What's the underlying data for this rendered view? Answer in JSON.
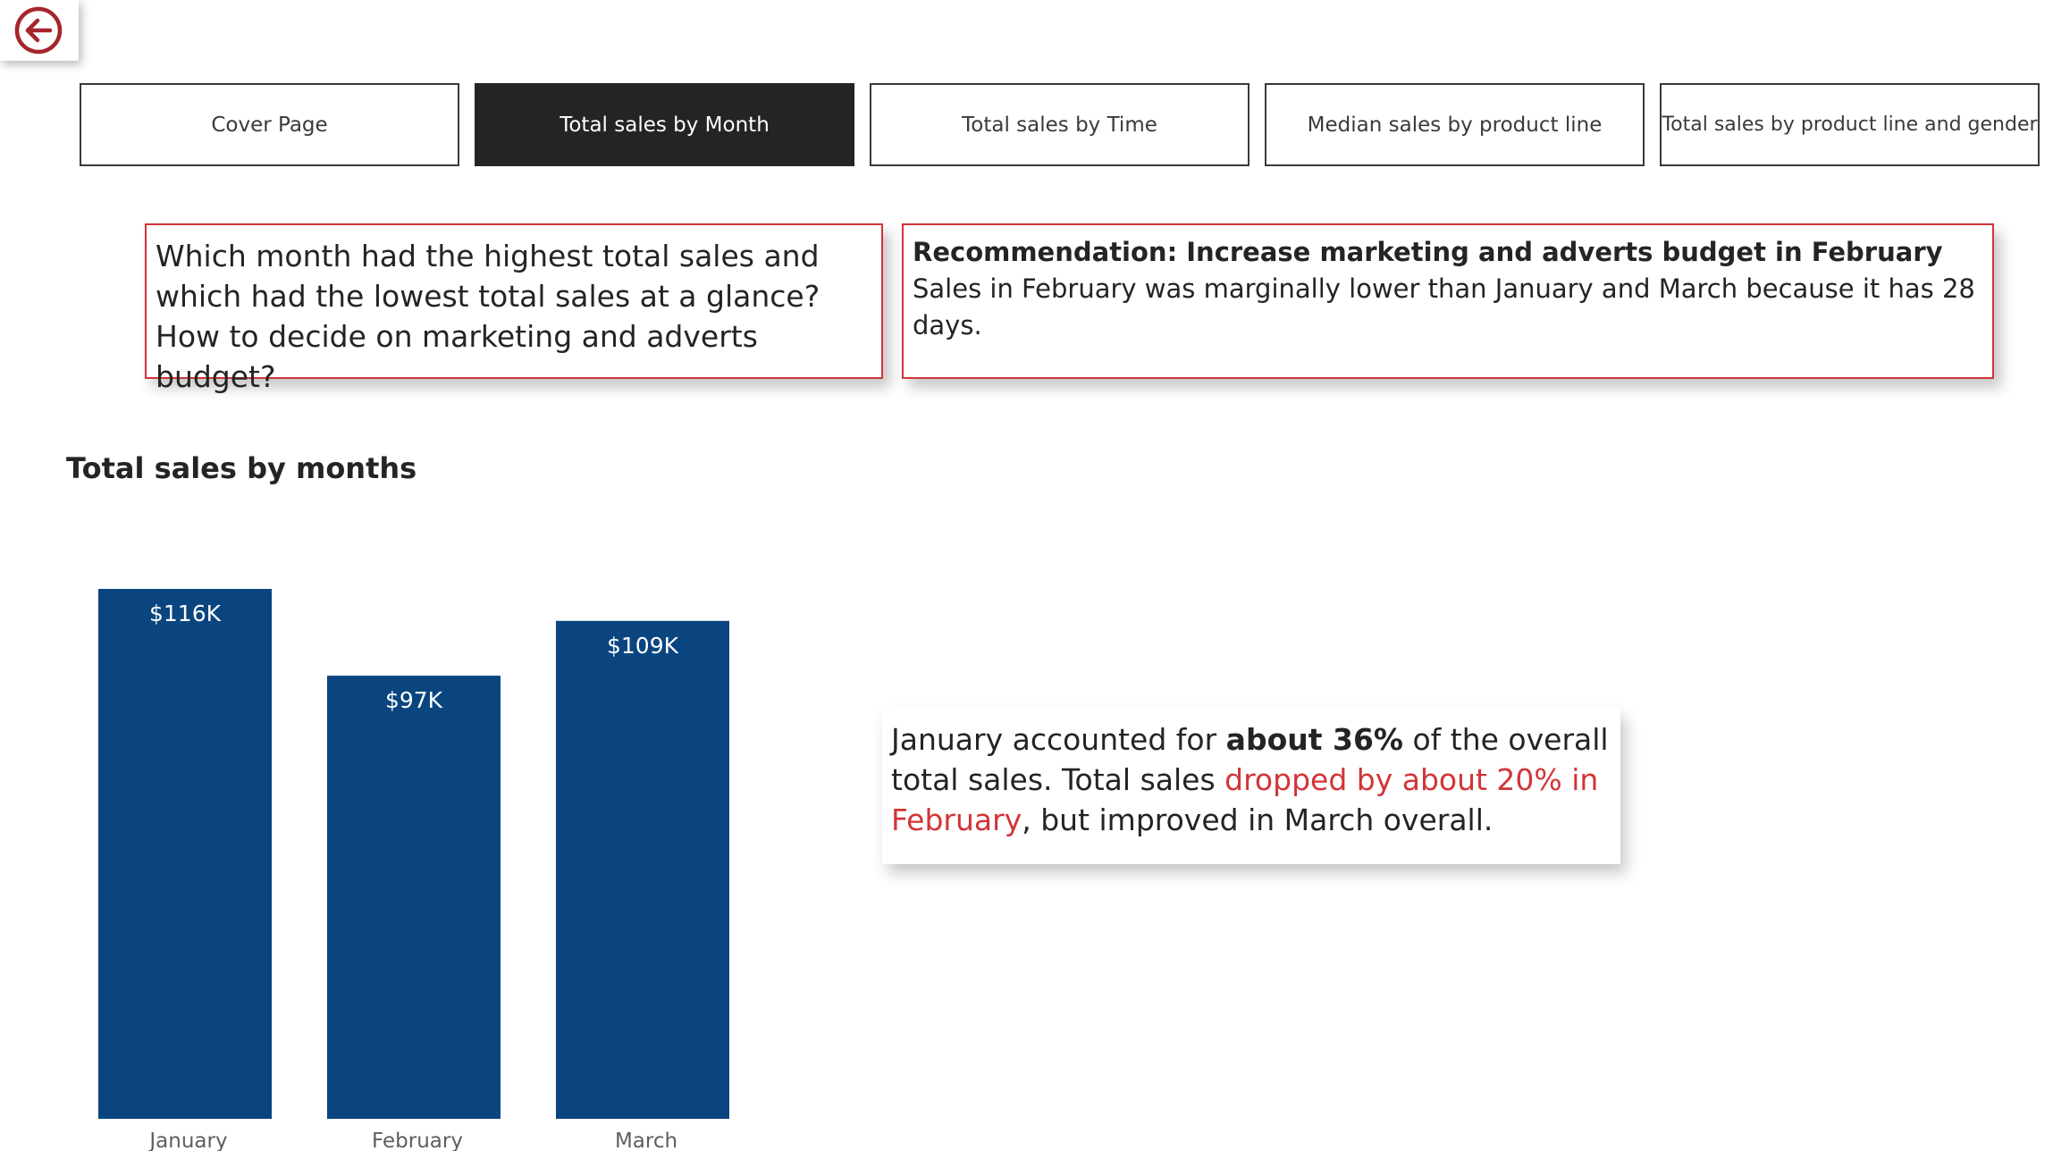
{
  "nav": {
    "back_icon": "back-arrow-circle-icon",
    "tabs": [
      {
        "label": "Cover Page",
        "active": false
      },
      {
        "label": "Total sales by Month",
        "active": true
      },
      {
        "label": "Total sales by Time",
        "active": false
      },
      {
        "label": "Median sales by product line",
        "active": false
      },
      {
        "label": "Total sales by product line and gender",
        "active": false
      }
    ]
  },
  "question": {
    "text": "Which month had the highest total sales and which had the lowest total sales at a glance? How to decide on marketing and adverts budget?"
  },
  "recommendation": {
    "title": "Recommendation: Increase marketing and adverts budget in February",
    "body": "Sales in February was marginally lower than January and March because it has 28 days."
  },
  "chart_title": "Total sales by months",
  "insight": {
    "part1": "January accounted for ",
    "bold": "about 36%",
    "part2": " of the overall total sales. Total sales ",
    "red": "dropped by about 20% in February",
    "part3": ", but improved in March overall."
  },
  "colors": {
    "bar": "#0a4580",
    "accent": "#d13438",
    "active_tab": "#252423"
  },
  "chart_data": {
    "type": "bar",
    "title": "Total sales by months",
    "categories": [
      "January",
      "February",
      "March"
    ],
    "values": [
      116,
      97,
      109
    ],
    "data_labels": [
      "$116K",
      "$97K",
      "$109K"
    ],
    "unit": "K USD",
    "ylim": [
      0,
      116
    ],
    "grid": false,
    "legend": "none"
  }
}
